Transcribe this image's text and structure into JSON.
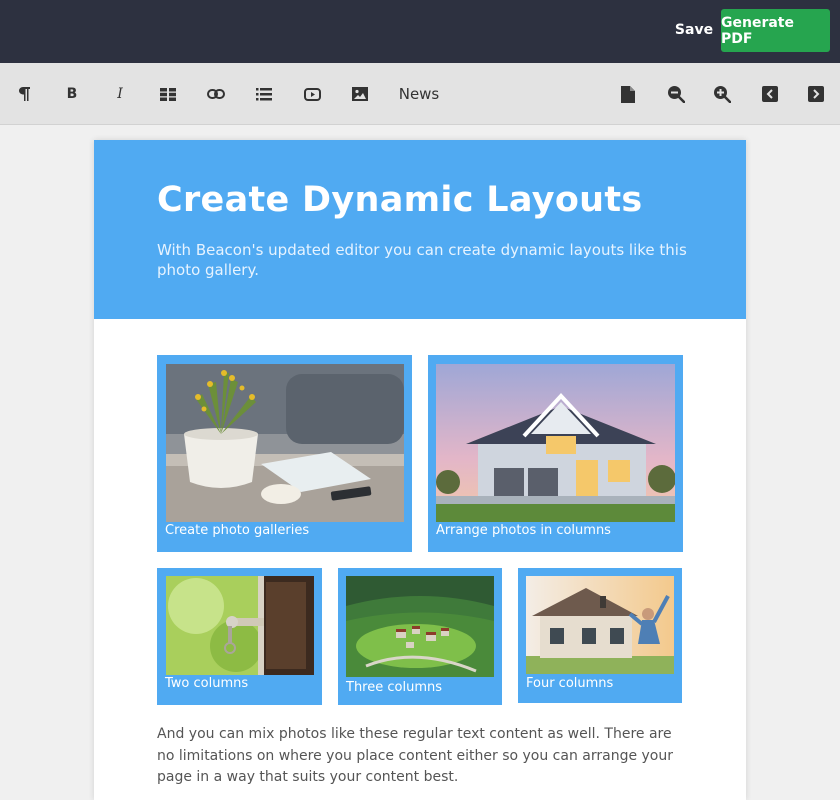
{
  "header": {
    "save_label": "Save",
    "generate_label": "Generate PDF"
  },
  "toolbar": {
    "bold_label": "B",
    "italic_label": "I",
    "news_label": "News"
  },
  "hero": {
    "title": "Create Dynamic Layouts",
    "subtitle": "With Beacon's updated editor you can create dynamic layouts like this photo gallery."
  },
  "gallery": {
    "row1": [
      {
        "caption": "Create photo galleries"
      },
      {
        "caption": "Arrange photos in columns"
      }
    ],
    "row2": [
      {
        "caption": "Two columns"
      },
      {
        "caption": "Three columns"
      },
      {
        "caption": "Four columns"
      }
    ]
  },
  "body_text": " And you can mix photos like these regular text content as well. There are no limitations on where you place content either so you can arrange your page in a way that suits your content best."
}
